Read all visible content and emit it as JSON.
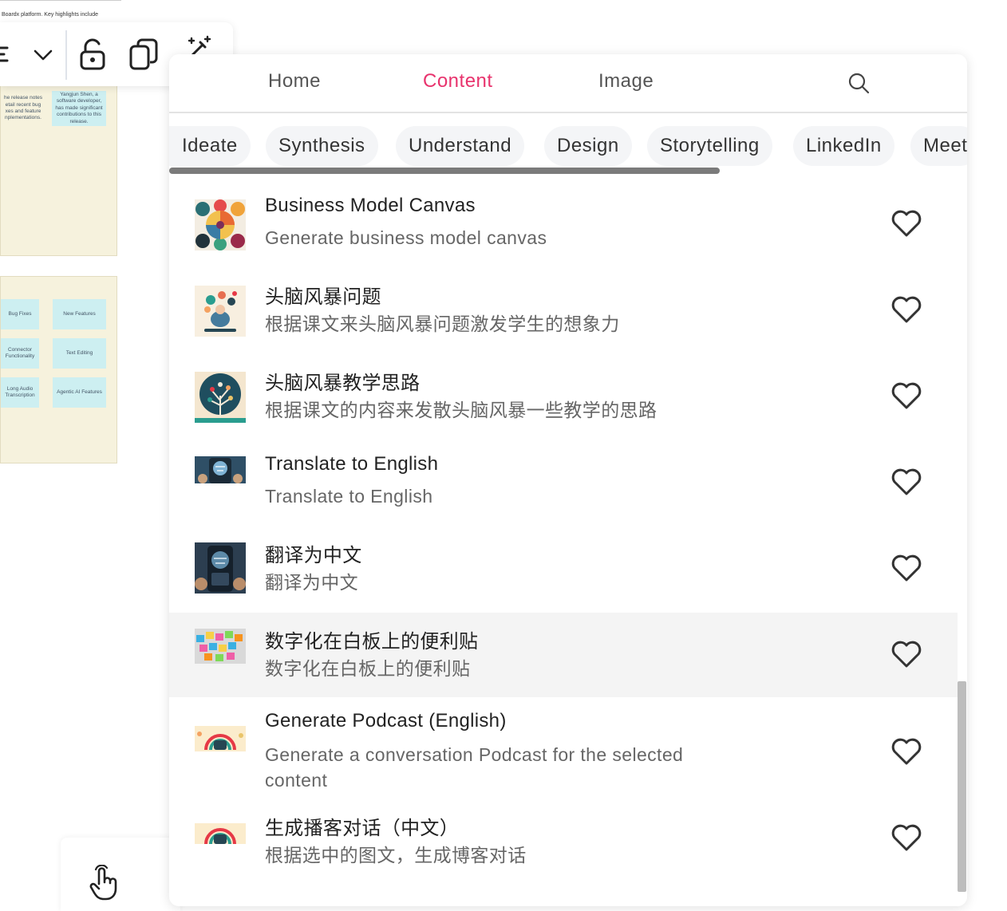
{
  "canvas": {
    "doc_snippet": "Boardx platform. Key highlights include",
    "board1_notes": [
      {
        "text": "he release notes etail recent bug xes and feature nplementations."
      },
      {
        "text": "Yangjun Shen, a software developer, has made significant contributions to this release."
      }
    ],
    "board2_notes": [
      {
        "text": "Bug Fixes"
      },
      {
        "text": "New Features"
      },
      {
        "text": "Connector Functionality"
      },
      {
        "text": "Text Editing"
      },
      {
        "text": "Long Audio Transcription"
      },
      {
        "text": "Agentic AI Features"
      }
    ]
  },
  "toolbar": {
    "icons": [
      "align-icon",
      "chevron-down-icon",
      "unlock-icon",
      "copy-icon",
      "magic-wand-icon"
    ]
  },
  "nav": {
    "tabs": [
      {
        "label": "Home"
      },
      {
        "label": "Content"
      },
      {
        "label": "Image"
      }
    ],
    "active_tab": "Content",
    "accent_color": "#e8336d"
  },
  "categories": [
    {
      "label": "Ideate"
    },
    {
      "label": "Synthesis"
    },
    {
      "label": "Understand"
    },
    {
      "label": "Design"
    },
    {
      "label": "Storytelling"
    },
    {
      "label": "LinkedIn"
    },
    {
      "label": "Meet"
    }
  ],
  "items": [
    {
      "title": "Business Model Canvas",
      "description": "Generate business model canvas",
      "thumb": "business-model-canvas"
    },
    {
      "title": "头脑风暴问题",
      "description": "根据课文来头脑风暴问题激发学生的想象力",
      "thumb": "brainstorm-questions"
    },
    {
      "title": "头脑风暴教学思路",
      "description": "根据课文的内容来发散头脑风暴一些教学的思路",
      "thumb": "brainstorm-tree"
    },
    {
      "title": "Translate to English",
      "description": "Translate to English",
      "thumb": "phone-globe"
    },
    {
      "title": "翻译为中文",
      "description": "翻译为中文",
      "thumb": "phone-globe-2"
    },
    {
      "title": "数字化在白板上的便利贴",
      "description": "数字化在白板上的便利贴",
      "thumb": "sticky-notes",
      "highlighted": true
    },
    {
      "title": "Generate Podcast (English)",
      "description": "Generate a conversation Podcast for the selected content",
      "thumb": "podcast"
    },
    {
      "title": "生成播客对话（中文）",
      "description": "根据选中的图文，生成博客对话",
      "thumb": "podcast-2"
    }
  ]
}
